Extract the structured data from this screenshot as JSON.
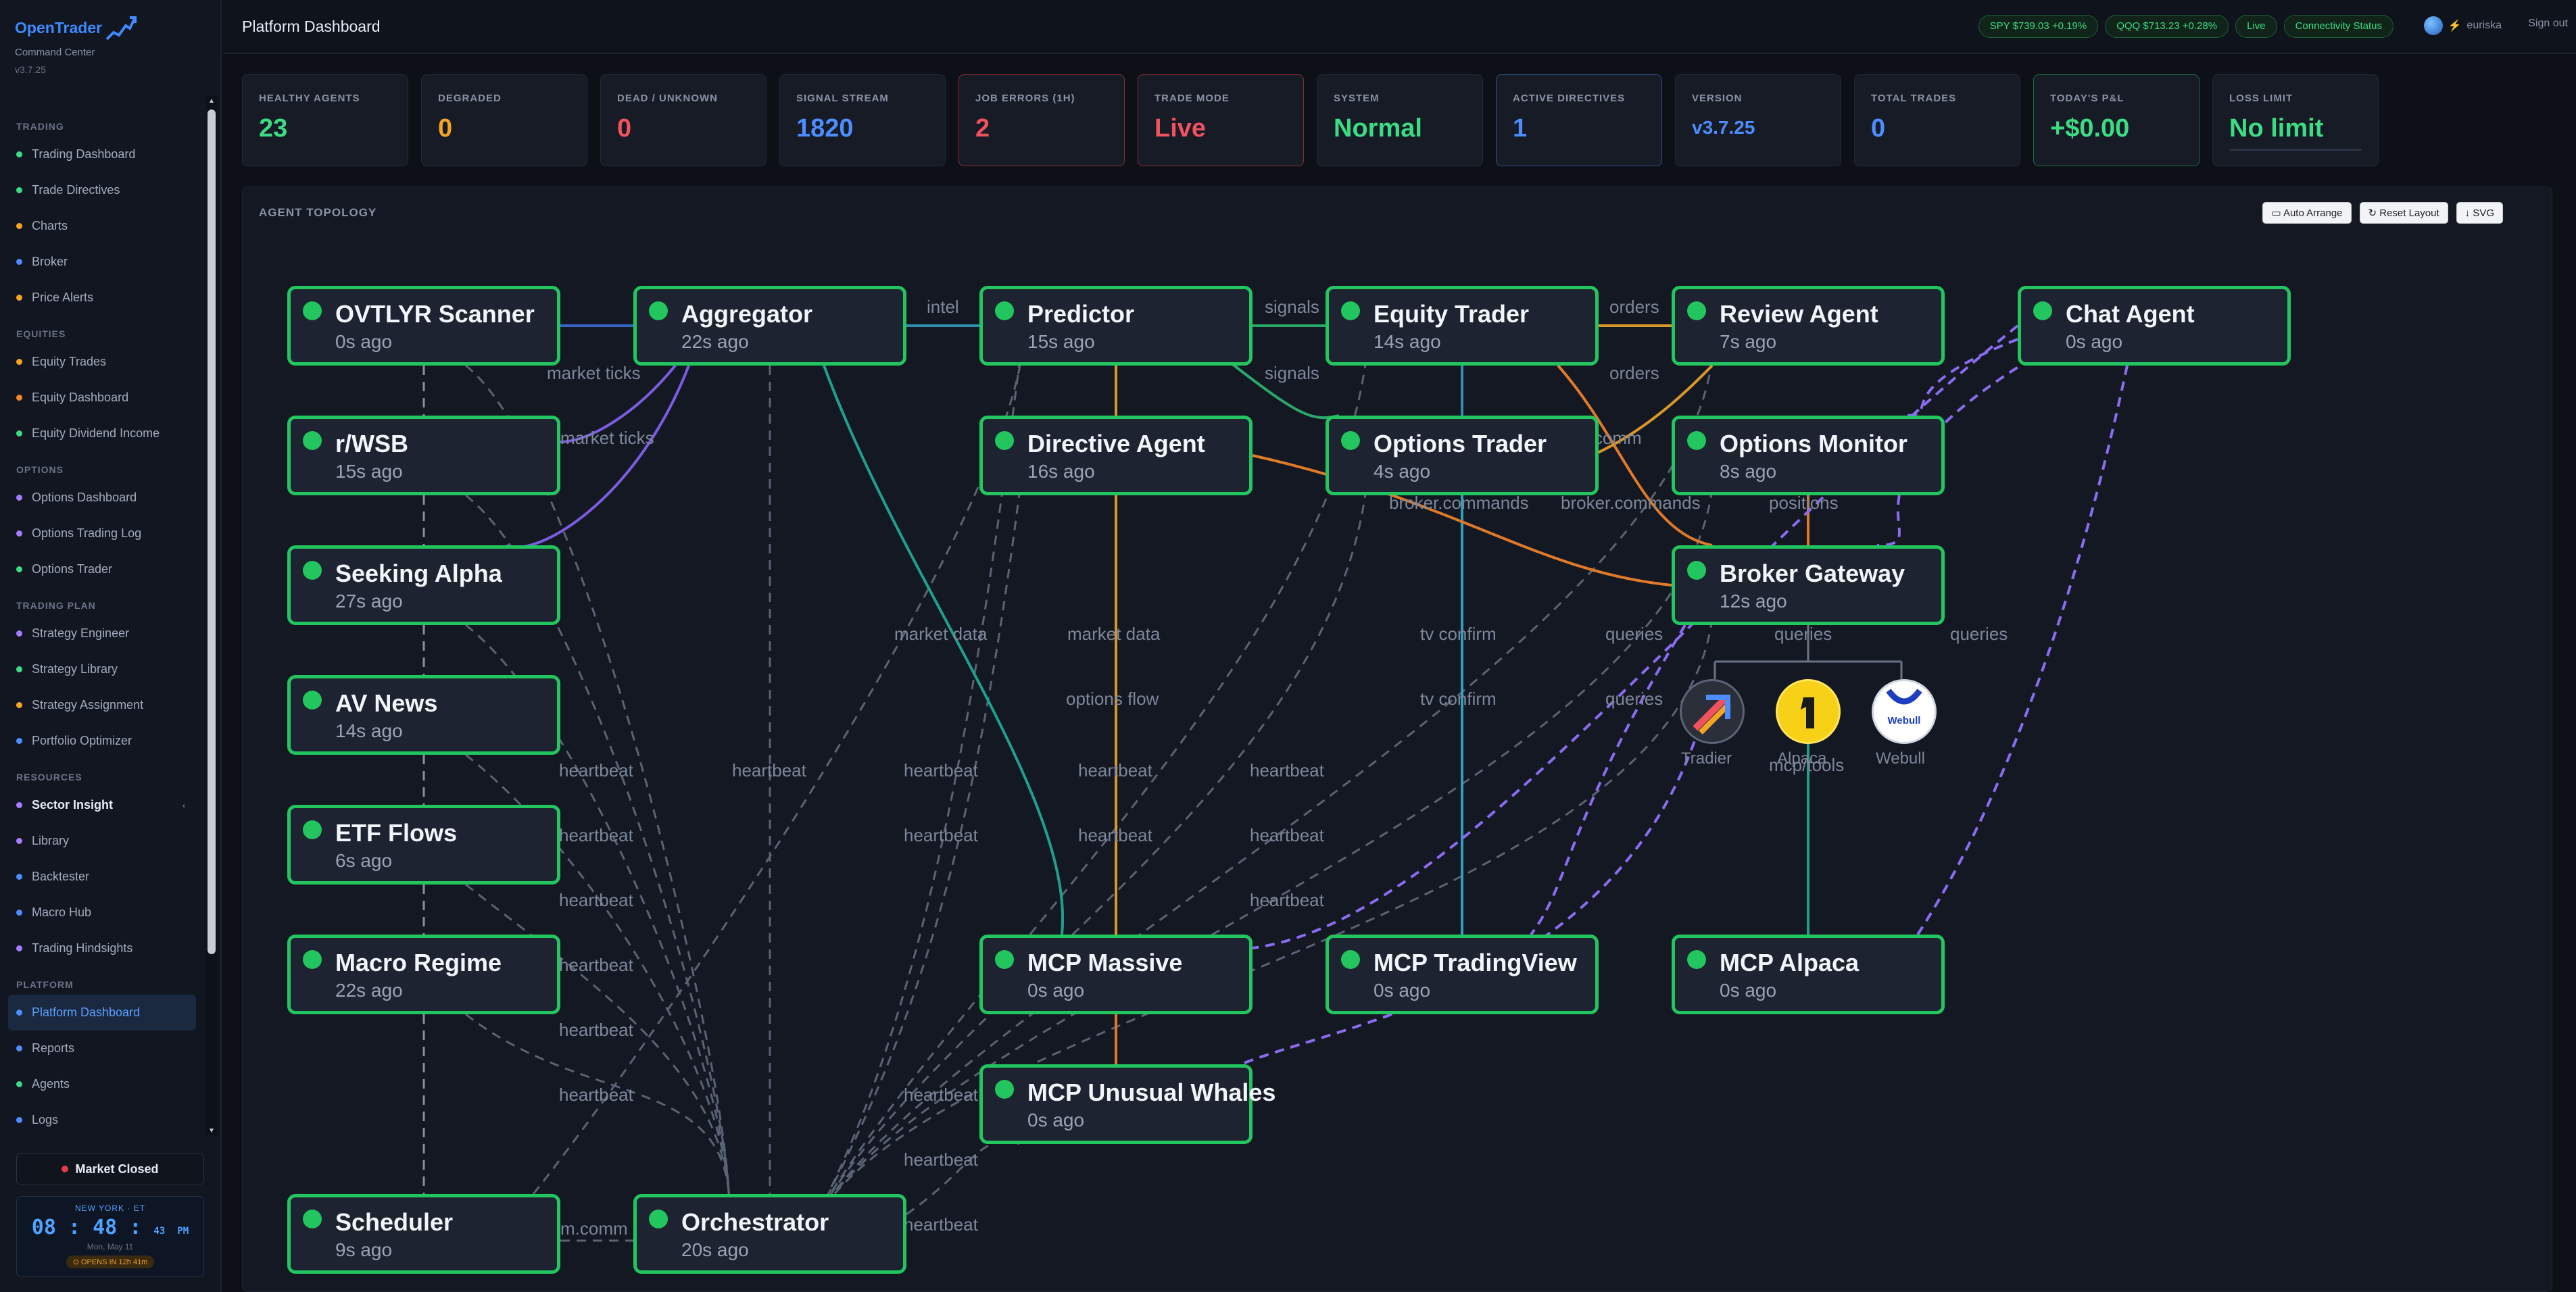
{
  "app": {
    "name": "OpenTrader",
    "subtitle": "Command Center",
    "version": "v3.7.25"
  },
  "sidebar": {
    "sections": [
      {
        "title": "TRADING",
        "items": [
          {
            "label": "Trading Dashboard",
            "color": "#3ddc84"
          },
          {
            "label": "Trade Directives",
            "color": "#3ddc84"
          },
          {
            "label": "Charts",
            "color": "#f5a524"
          },
          {
            "label": "Broker",
            "color": "#4d8dff"
          },
          {
            "label": "Price Alerts",
            "color": "#f5a524"
          }
        ]
      },
      {
        "title": "EQUITIES",
        "items": [
          {
            "label": "Equity Trades",
            "color": "#f5a524"
          },
          {
            "label": "Equity Dashboard",
            "color": "#f08a24"
          },
          {
            "label": "Equity Dividend Income",
            "color": "#3ddc84"
          }
        ]
      },
      {
        "title": "OPTIONS",
        "items": [
          {
            "label": "Options Dashboard",
            "color": "#a97cff"
          },
          {
            "label": "Options Trading Log",
            "color": "#a97cff"
          },
          {
            "label": "Options Trader",
            "color": "#3ddc84"
          }
        ]
      },
      {
        "title": "TRADING PLAN",
        "items": [
          {
            "label": "Strategy Engineer",
            "color": "#a97cff"
          },
          {
            "label": "Strategy Library",
            "color": "#3ddc84"
          },
          {
            "label": "Strategy Assignment",
            "color": "#f5a524"
          },
          {
            "label": "Portfolio Optimizer",
            "color": "#4d8dff"
          }
        ]
      },
      {
        "title": "RESOURCES",
        "items": [
          {
            "label": "Sector Insight",
            "color": "#a97cff",
            "bold": true,
            "chev": "‹"
          },
          {
            "label": "Library",
            "color": "#a97cff"
          },
          {
            "label": "Backtester",
            "color": "#4d8dff"
          },
          {
            "label": "Macro Hub",
            "color": "#4d8dff"
          },
          {
            "label": "Trading Hindsights",
            "color": "#a97cff"
          }
        ]
      },
      {
        "title": "PLATFORM",
        "items": [
          {
            "label": "Platform Dashboard",
            "color": "#4d8dff",
            "active": true
          },
          {
            "label": "Reports",
            "color": "#4d8dff"
          },
          {
            "label": "Agents",
            "color": "#3ddc84"
          },
          {
            "label": "Logs",
            "color": "#4d8dff"
          }
        ]
      }
    ],
    "market_status": "Market Closed",
    "clock": {
      "city": "NEW YORK · ET",
      "time_h": "08",
      "time_m": "48",
      "time_s": "43",
      "ampm": "PM",
      "date": "Mon, May 11",
      "opens": "⊙ OPENS IN 12h 41m"
    }
  },
  "header": {
    "title": "Platform Dashboard",
    "pills": [
      {
        "text": "SPY $739.03 +0.19%",
        "style": "green"
      },
      {
        "text": "QQQ $713.23 +0.28%",
        "style": "green"
      },
      {
        "text": "Live",
        "style": "green"
      },
      {
        "text": "Connectivity Status",
        "style": "green"
      }
    ],
    "user": "euriska",
    "signout": "Sign out"
  },
  "stats": [
    {
      "label": "HEALTHY AGENTS",
      "value": "23",
      "color": "green",
      "border": ""
    },
    {
      "label": "DEGRADED",
      "value": "0",
      "color": "amber",
      "border": ""
    },
    {
      "label": "DEAD / UNKNOWN",
      "value": "0",
      "color": "red",
      "border": ""
    },
    {
      "label": "SIGNAL STREAM",
      "value": "1820",
      "color": "blue",
      "border": ""
    },
    {
      "label": "JOB ERRORS (1H)",
      "value": "2",
      "color": "red",
      "border": "red"
    },
    {
      "label": "TRADE MODE",
      "value": "Live",
      "color": "red",
      "border": "red"
    },
    {
      "label": "SYSTEM",
      "value": "Normal",
      "color": "green",
      "border": ""
    },
    {
      "label": "ACTIVE DIRECTIVES",
      "value": "1",
      "color": "blue",
      "border": "blue"
    },
    {
      "label": "VERSION",
      "value": "v3.7.25",
      "color": "blue",
      "border": "",
      "small": true
    },
    {
      "label": "TOTAL TRADES",
      "value": "0",
      "color": "blue",
      "border": ""
    },
    {
      "label": "TODAY'S P&L",
      "value": "+$0.00",
      "color": "green",
      "border": "green"
    },
    {
      "label": "LOSS LIMIT",
      "value": "No limit",
      "color": "green",
      "border": "",
      "bar": true
    }
  ],
  "topology": {
    "title": "AGENT TOPOLOGY",
    "buttons": [
      "▭ Auto Arrange",
      "↻ Reset Layout",
      "↓ SVG"
    ],
    "nodes": [
      {
        "id": "ovtlyr",
        "name": "OVTLYR Scanner",
        "age": "0s ago"
      },
      {
        "id": "aggregator",
        "name": "Aggregator",
        "age": "22s ago"
      },
      {
        "id": "predictor",
        "name": "Predictor",
        "age": "15s ago"
      },
      {
        "id": "equity",
        "name": "Equity Trader",
        "age": "14s ago"
      },
      {
        "id": "review",
        "name": "Review Agent",
        "age": "7s ago"
      },
      {
        "id": "chat",
        "name": "Chat Agent",
        "age": "0s ago"
      },
      {
        "id": "rwsb",
        "name": "r/WSB",
        "age": "15s ago"
      },
      {
        "id": "directive",
        "name": "Directive Agent",
        "age": "16s ago"
      },
      {
        "id": "optionstrader",
        "name": "Options Trader",
        "age": "4s ago"
      },
      {
        "id": "optionsmon",
        "name": "Options Monitor",
        "age": "8s ago"
      },
      {
        "id": "seeking",
        "name": "Seeking Alpha",
        "age": "27s ago"
      },
      {
        "id": "broker",
        "name": "Broker Gateway",
        "age": "12s ago"
      },
      {
        "id": "avnews",
        "name": "AV News",
        "age": "14s ago"
      },
      {
        "id": "etf",
        "name": "ETF Flows",
        "age": "6s ago"
      },
      {
        "id": "macro",
        "name": "Macro Regime",
        "age": "22s ago"
      },
      {
        "id": "mcpmassive",
        "name": "MCP Massive",
        "age": "0s ago"
      },
      {
        "id": "mcptv",
        "name": "MCP TradingView",
        "age": "0s ago"
      },
      {
        "id": "mcpalpaca",
        "name": "MCP Alpaca",
        "age": "0s ago"
      },
      {
        "id": "mcpuw",
        "name": "MCP Unusual Whales",
        "age": "0s ago"
      },
      {
        "id": "scheduler",
        "name": "Scheduler",
        "age": "9s ago"
      },
      {
        "id": "orchestrator",
        "name": "Orchestrator",
        "age": "20s ago"
      }
    ],
    "edge_labels": [
      "intel",
      "signals",
      "orders",
      "market ticks",
      "signals",
      "orders",
      "market ticks",
      "er.comm",
      "broker.commands",
      "broker.commands",
      "positions",
      "market data",
      "market data",
      "tv confirm",
      "queries",
      "queries",
      "queries",
      "options flow",
      "tv confirm",
      "queries",
      "mcp/tools",
      "heartbeat",
      "heartbeat",
      "heartbeat",
      "heartbeat",
      "heartbeat",
      "heartbeat",
      "heartbeat",
      "heartbeat",
      "heartbeat",
      "heartbeat",
      "heartbeat",
      "heartbeat",
      "heartbeat",
      "heartbeat",
      "heartbeat",
      "m.comm"
    ],
    "brokers": [
      {
        "name": "Tradier",
        "icon": "tradier-icon"
      },
      {
        "name": "Alpaca",
        "icon": "alpaca-icon"
      },
      {
        "name": "Webull",
        "icon": "webull-icon",
        "text": "Webull"
      }
    ]
  }
}
